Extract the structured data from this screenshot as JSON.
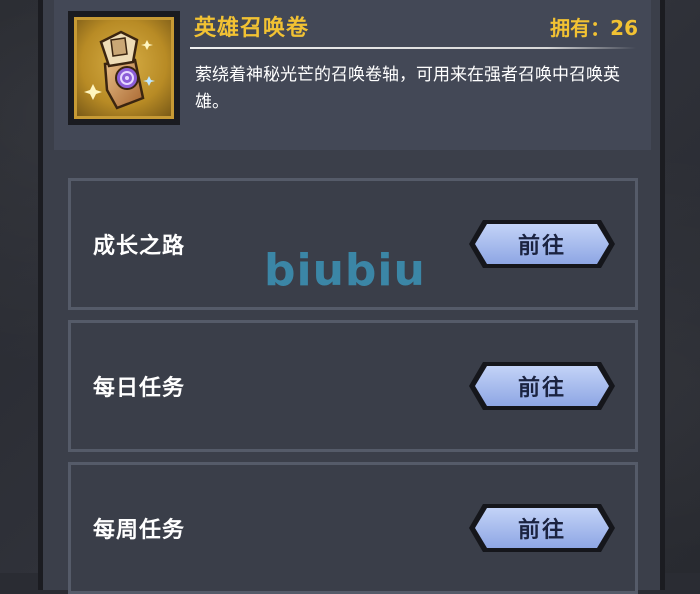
{
  "item": {
    "name": "英雄召唤卷",
    "owned_text": "拥有：26",
    "description": "萦绕着神秘光芒的召唤卷轴，可用来在强者召唤中召唤英雄。",
    "icon": "summon-scroll-icon"
  },
  "sources": [
    {
      "label": "成长之路",
      "button": "前往"
    },
    {
      "label": "每日任务",
      "button": "前往"
    },
    {
      "label": "每周任务",
      "button": "前往"
    }
  ],
  "watermark": "biubiu",
  "colors": {
    "title_gold": "#f2c233",
    "button_blue": "#9db3ea",
    "panel": "#3a3e49"
  }
}
